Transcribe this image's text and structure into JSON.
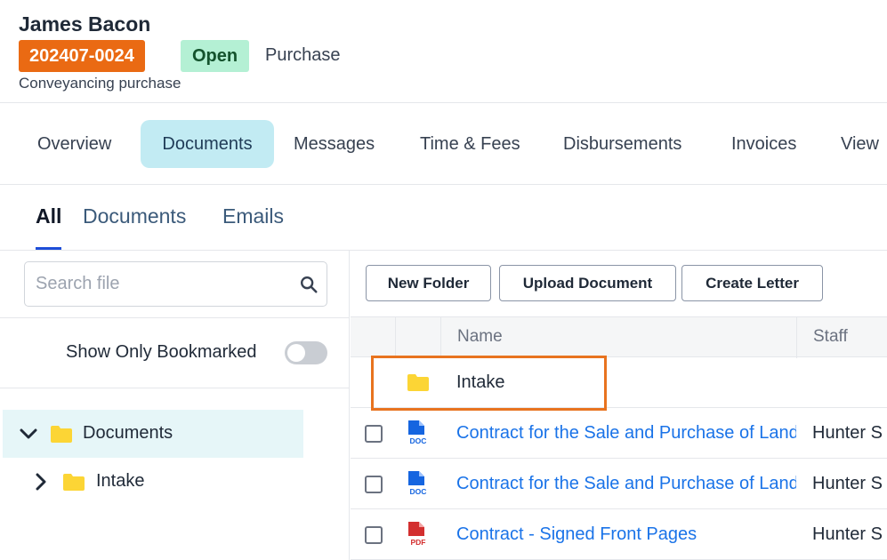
{
  "header": {
    "client_name": "James Bacon",
    "matter_number": "202407-0024",
    "status": "Open",
    "matter_type": "Purchase",
    "description": "Conveyancing purchase"
  },
  "tabs": [
    {
      "label": "Overview",
      "active": false
    },
    {
      "label": "Documents",
      "active": true
    },
    {
      "label": "Messages",
      "active": false
    },
    {
      "label": "Time & Fees",
      "active": false
    },
    {
      "label": "Disbursements",
      "active": false
    },
    {
      "label": "Invoices",
      "active": false
    },
    {
      "label": "View",
      "active": false
    }
  ],
  "subtabs": [
    {
      "label": "All",
      "active": true
    },
    {
      "label": "Documents",
      "active": false
    },
    {
      "label": "Emails",
      "active": false
    }
  ],
  "search": {
    "placeholder": "Search file",
    "value": "",
    "icon": "search-icon"
  },
  "bookmark_filter": {
    "label": "Show Only Bookmarked",
    "enabled": false
  },
  "tree": [
    {
      "label": "Documents",
      "expanded": true,
      "selected": true,
      "icon": "folder-icon"
    },
    {
      "label": "Intake",
      "expanded": false,
      "selected": false,
      "icon": "folder-icon"
    }
  ],
  "toolbar": {
    "new_folder": "New Folder",
    "upload_document": "Upload Document",
    "create_letter": "Create Letter"
  },
  "table": {
    "columns": [
      "Name",
      "Staff"
    ],
    "rows": [
      {
        "type": "folder",
        "name": "Intake",
        "staff": ""
      },
      {
        "type": "doc",
        "icon_label": "DOC",
        "name": "Contract for the Sale and Purchase of Land",
        "staff": "Hunter S"
      },
      {
        "type": "doc",
        "icon_label": "DOC",
        "name": "Contract for the Sale and Purchase of Land",
        "staff": "Hunter S"
      },
      {
        "type": "pdf",
        "icon_label": "PDF",
        "name": "Contract - Signed Front Pages",
        "staff": "Hunter S"
      }
    ]
  },
  "colors": {
    "accent_orange": "#ea6a13",
    "status_green": "#b4f0d4",
    "active_tab_bg": "#c2ebf3",
    "link_blue": "#1a73e8",
    "folder_yellow": "#fcd535",
    "doc_blue": "#1565e0",
    "pdf_red": "#d32f2f",
    "highlight_orange": "#e8731f"
  }
}
